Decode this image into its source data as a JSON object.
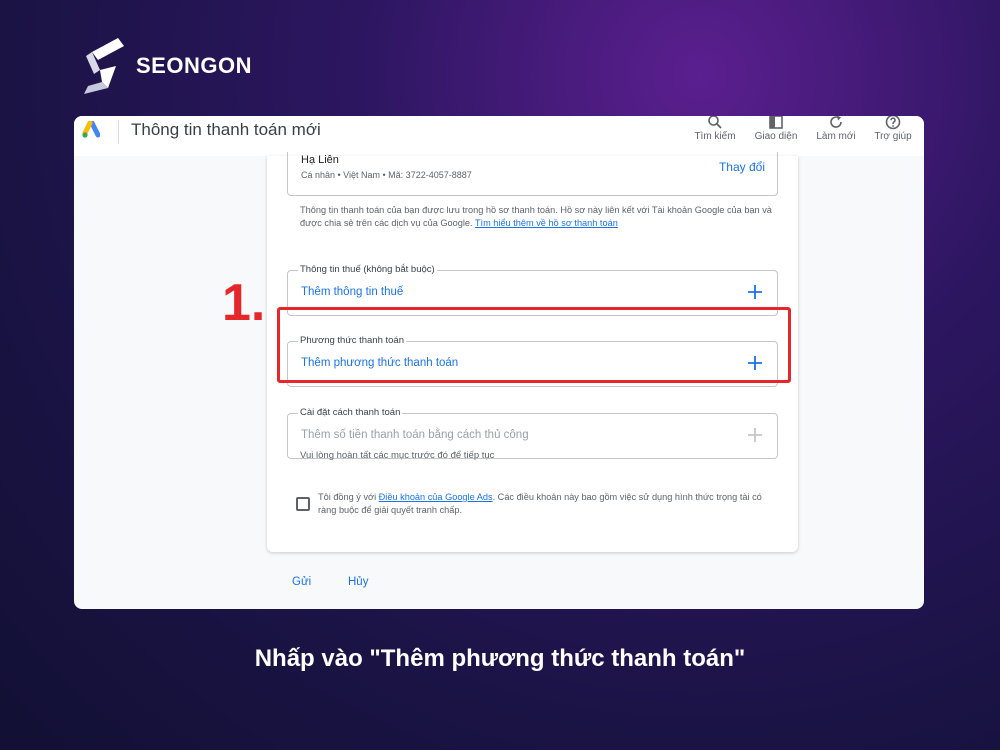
{
  "brand": {
    "name": "SEONGON"
  },
  "window": {
    "title": "Thông tin thanh toán mới",
    "tools": [
      {
        "label": "Tìm kiếm",
        "icon": "search-icon"
      },
      {
        "label": "Giao diện",
        "icon": "appearance-icon"
      },
      {
        "label": "Làm mới",
        "icon": "refresh-icon"
      },
      {
        "label": "Trợ giúp",
        "icon": "help-icon"
      }
    ]
  },
  "profile": {
    "name": "Hạ Liên",
    "meta": "Cá nhân • Việt Nam • Mã: 3722-4057-8887",
    "change_label": "Thay đổi"
  },
  "profile_info": {
    "text": "Thông tin thanh toán của bạn được lưu trong hồ sơ thanh toán. Hồ sơ này liên kết với Tài khoản Google của bạn và được chia sẻ trên các dịch vụ của Google. ",
    "link": "Tìm hiểu thêm về hồ sơ thanh toán"
  },
  "tax": {
    "label": "Thông tin thuế (không bắt buộc)",
    "action": "Thêm thông tin thuế"
  },
  "payment_method": {
    "label": "Phương thức thanh toán",
    "action": "Thêm phương thức thanh toán"
  },
  "payment_setting": {
    "label": "Cài đặt cách thanh toán",
    "action": "Thêm số tiền thanh toán bằng cách thủ công"
  },
  "hint": "Vui lòng hoàn tất các mục trước đó để tiếp tục",
  "agreement": {
    "prefix": "Tôi đồng ý với ",
    "link": "Điều khoản của Google Ads",
    "suffix": ". Các điều khoản này bao gồm việc sử dụng hình thức trọng tài có ràng buộc để giải quyết tranh chấp."
  },
  "actions": {
    "submit": "Gửi",
    "cancel": "Hủy"
  },
  "annotation": {
    "step": "1.",
    "caption": "Nhấp vào \"Thêm phương thức thanh toán\""
  },
  "colors": {
    "accent_blue": "#1a73e8",
    "highlight_red": "#e5262a"
  }
}
